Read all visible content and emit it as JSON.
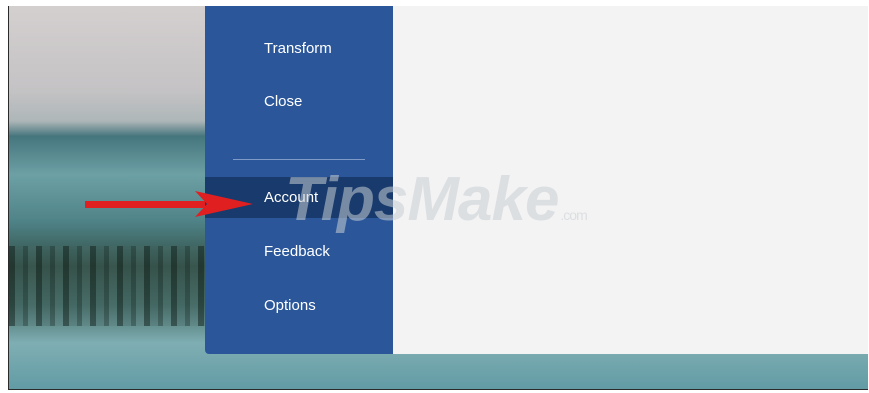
{
  "menu": {
    "items": [
      {
        "label": "Transform",
        "selected": false
      },
      {
        "label": "Close",
        "selected": false
      },
      {
        "label": "Account",
        "selected": true
      },
      {
        "label": "Feedback",
        "selected": false
      },
      {
        "label": "Options",
        "selected": false
      }
    ]
  },
  "watermark": {
    "text": "TipsMake",
    "suffix": ".com"
  },
  "colors": {
    "menu_background": "#2b579a",
    "menu_selected": "#183a6c",
    "content_background": "#f3f3f3",
    "arrow": "#e02020"
  },
  "annotation": {
    "icon": "red-arrow-icon"
  }
}
